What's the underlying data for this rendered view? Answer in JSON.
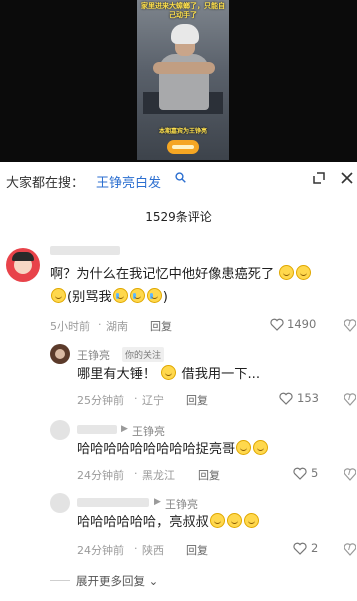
{
  "video": {
    "caption": "家里进来大蟑螂了，只能自己动手了",
    "subtitle": "本期嘉宾为王铮亮"
  },
  "search": {
    "prefix": "大家都在搜：",
    "term": "王铮亮白发",
    "search_icon": "search-icon"
  },
  "comments_header": {
    "count_label": "1529条评论"
  },
  "comments": [
    {
      "text_line1": "啊？为什么在我记忆中他好像患癌死了",
      "text_line2_open": "(别骂我",
      "text_line2_close": ")",
      "time": "5小时前",
      "location": "湖南",
      "reply_label": "回复",
      "likes": "1490",
      "replies": [
        {
          "author": "王铮亮",
          "badge": "你的关注",
          "text_a": "哪里有大锤！",
          "text_b": "借我用一下...",
          "time": "25分钟前",
          "location": "辽宁",
          "reply_label": "回复",
          "likes": "153"
        },
        {
          "reply_to": "王铮亮",
          "text": "哈哈哈哈哈哈哈哈哈捉亮哥",
          "time": "24分钟前",
          "location": "黑龙江",
          "reply_label": "回复",
          "likes": "5"
        },
        {
          "reply_to": "王铮亮",
          "text": "哈哈哈哈哈哈，亮叔叔",
          "time": "24分钟前",
          "location": "陕西",
          "reply_label": "回复",
          "likes": "2"
        }
      ],
      "expand_label": "展开更多回复"
    }
  ],
  "colors": {
    "accent_blue": "#2c6fd0",
    "emoji_yellow": "#ffd84d"
  }
}
